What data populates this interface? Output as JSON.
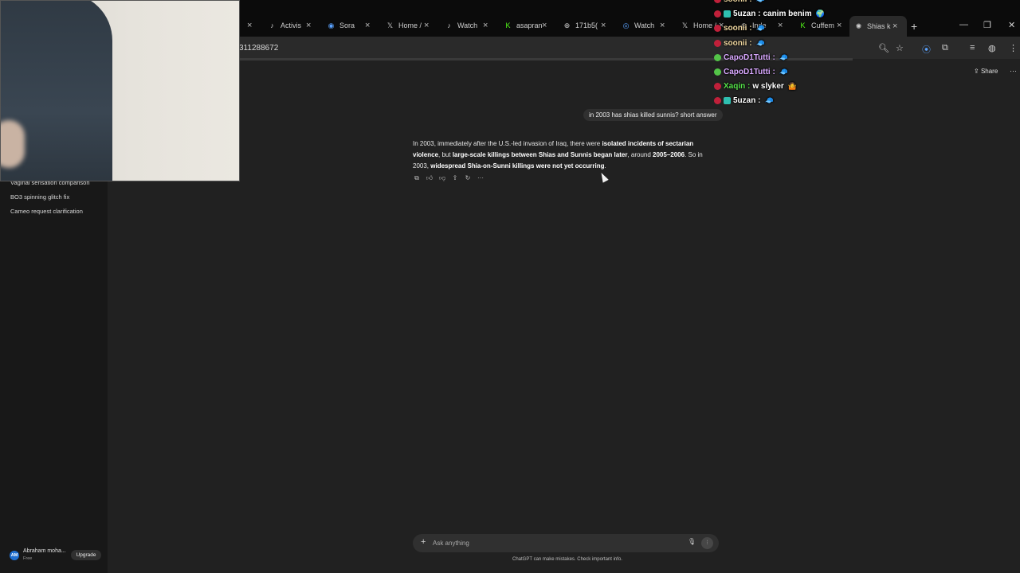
{
  "browser": {
    "tabs": [
      {
        "label": "Activis",
        "icon": "tiktok-icon",
        "glyph": "♪"
      },
      {
        "label": "Sora",
        "icon": "sora-icon",
        "glyph": "◉"
      },
      {
        "label": "Home /",
        "icon": "x-icon",
        "glyph": "𝕏"
      },
      {
        "label": "Watch",
        "icon": "tiktok-icon",
        "glyph": "♪"
      },
      {
        "label": "asapran",
        "icon": "kick-icon",
        "glyph": "K"
      },
      {
        "label": "171b5(",
        "icon": "globe-icon",
        "glyph": "⊕"
      },
      {
        "label": "Watch",
        "icon": "watch-icon",
        "glyph": "◎"
      },
      {
        "label": "Home /",
        "icon": "x-icon",
        "glyph": "𝕏"
      },
      {
        "label": "Inde",
        "icon": "globe-icon",
        "glyph": "⊕"
      },
      {
        "label": "Cuffem",
        "icon": "kick-icon",
        "glyph": "K"
      },
      {
        "label": "Shias k",
        "icon": "chatgpt-icon",
        "glyph": "✺"
      }
    ],
    "url_fragment": "311288672"
  },
  "sidebar": {
    "items": [
      "Vaginal sensation comparison",
      "BO3 spinning glitch fix",
      "Cameo request clarification"
    ],
    "user": {
      "initials": "AM",
      "name": "Abraham moha...",
      "plan": "Free",
      "upgrade_label": "Upgrade"
    }
  },
  "header": {
    "share_label": "Share"
  },
  "conversation": {
    "user_message": "in 2003 has shias killed sunnis? short answer",
    "answer_parts": [
      {
        "text": "In 2003, immediately after the U.S.-led invasion of Iraq, there were ",
        "bold": false
      },
      {
        "text": "isolated incidents of sectarian violence",
        "bold": true
      },
      {
        "text": ", but ",
        "bold": false
      },
      {
        "text": "large-scale killings between Shias and Sunnis began later",
        "bold": false,
        "semi": true
      },
      {
        "text": ", around ",
        "bold": false
      },
      {
        "text": "2005–2006",
        "bold": true
      },
      {
        "text": ". So in 2003, ",
        "bold": false
      },
      {
        "text": "widespread Shia-on-Sunni killings were not yet occurring",
        "bold": true
      },
      {
        "text": ".",
        "bold": false
      }
    ]
  },
  "composer": {
    "placeholder": "Ask anything"
  },
  "disclaimer": "ChatGPT can make mistakes. Check important info.",
  "stream_chat": [
    {
      "user": "soonii",
      "message": "",
      "name_color": "#f0d8a0",
      "badge_color": "#c0203a",
      "emote": "🧢"
    },
    {
      "user": "5uzan",
      "message": "canim benim",
      "name_color": "#ffffff",
      "badge_color": "#c0203a",
      "emote": "🌍"
    },
    {
      "user": "soonii",
      "message": "",
      "name_color": "#f0d8a0",
      "badge_color": "#c0203a",
      "emote": "🧢"
    },
    {
      "user": "soonii",
      "message": "",
      "name_color": "#f0d8a0",
      "badge_color": "#c0203a",
      "emote": "🧢"
    },
    {
      "user": "CapoD1Tutti",
      "message": "",
      "name_color": "#d9a8ff",
      "badge_color": "#53c448",
      "emote": "🧢"
    },
    {
      "user": "CapoD1Tutti",
      "message": "",
      "name_color": "#d9a8ff",
      "badge_color": "#53c448",
      "emote": "🧢"
    },
    {
      "user": "Xaqin",
      "message": "w slyker",
      "name_color": "#55e24a",
      "badge_color": "#c0203a",
      "emote": "🤷"
    },
    {
      "user": "5uzan",
      "message": "",
      "name_color": "#ffffff",
      "badge_color": "#c0203a",
      "emote": "🧢"
    }
  ]
}
